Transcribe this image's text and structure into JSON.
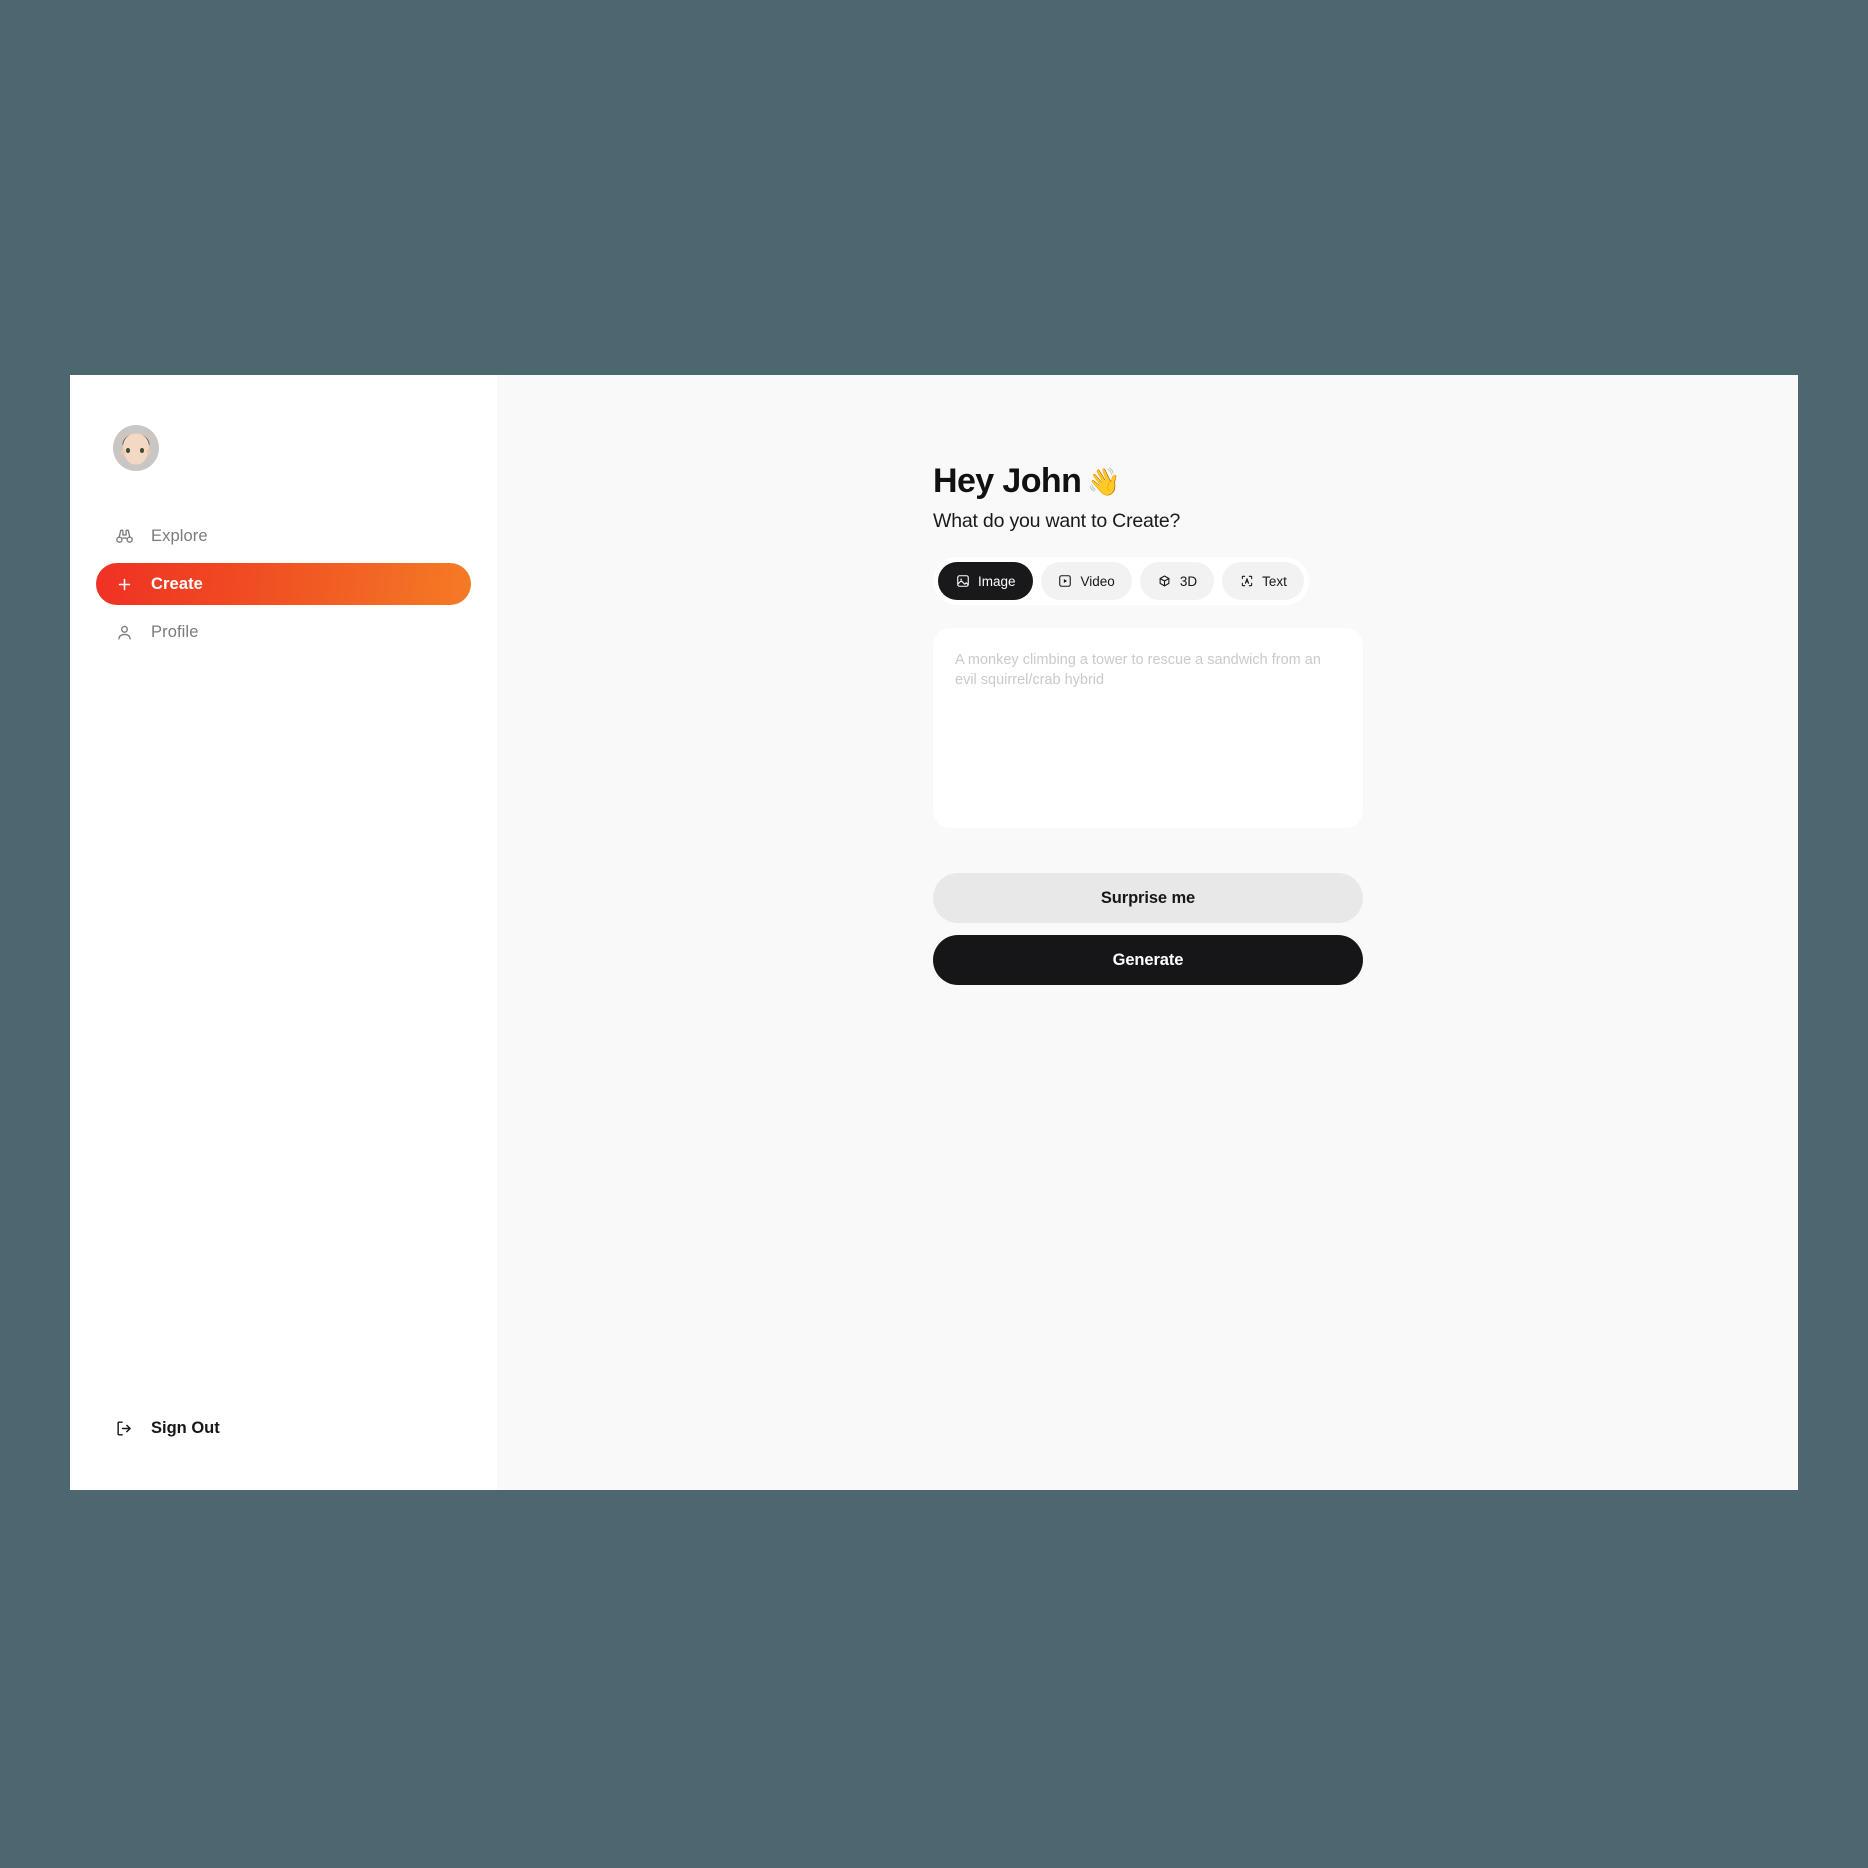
{
  "theme": {
    "page_background": "#4c6770",
    "sidebar_background": "#ffffff",
    "main_background": "#f9f9f9",
    "accent_gradient_start": "#ef3124",
    "accent_gradient_end": "#f47b25",
    "dark": "#161619"
  },
  "sidebar": {
    "avatar": {
      "icon": "user-avatar-memoji"
    },
    "items": [
      {
        "label": "Explore",
        "icon": "binoculars-icon",
        "active": false
      },
      {
        "label": "Create",
        "icon": "plus-icon",
        "active": true
      },
      {
        "label": "Profile",
        "icon": "person-icon",
        "active": false
      }
    ],
    "sign_out": {
      "label": "Sign Out",
      "icon": "logout-icon"
    }
  },
  "main": {
    "greeting": "Hey John",
    "greeting_emoji": "👋",
    "subtitle": "What do you want to Create?",
    "tabs": [
      {
        "label": "Image",
        "icon": "image-icon",
        "active": true
      },
      {
        "label": "Video",
        "icon": "video-icon",
        "active": false
      },
      {
        "label": "3D",
        "icon": "cube-icon",
        "active": false
      },
      {
        "label": "Text",
        "icon": "text-frame-icon",
        "active": false
      }
    ],
    "prompt": {
      "value": "",
      "placeholder": "A monkey climbing a tower to rescue a sandwich from an evil squirrel/crab hybrid"
    },
    "buttons": {
      "surprise": "Surprise me",
      "generate": "Generate"
    }
  }
}
